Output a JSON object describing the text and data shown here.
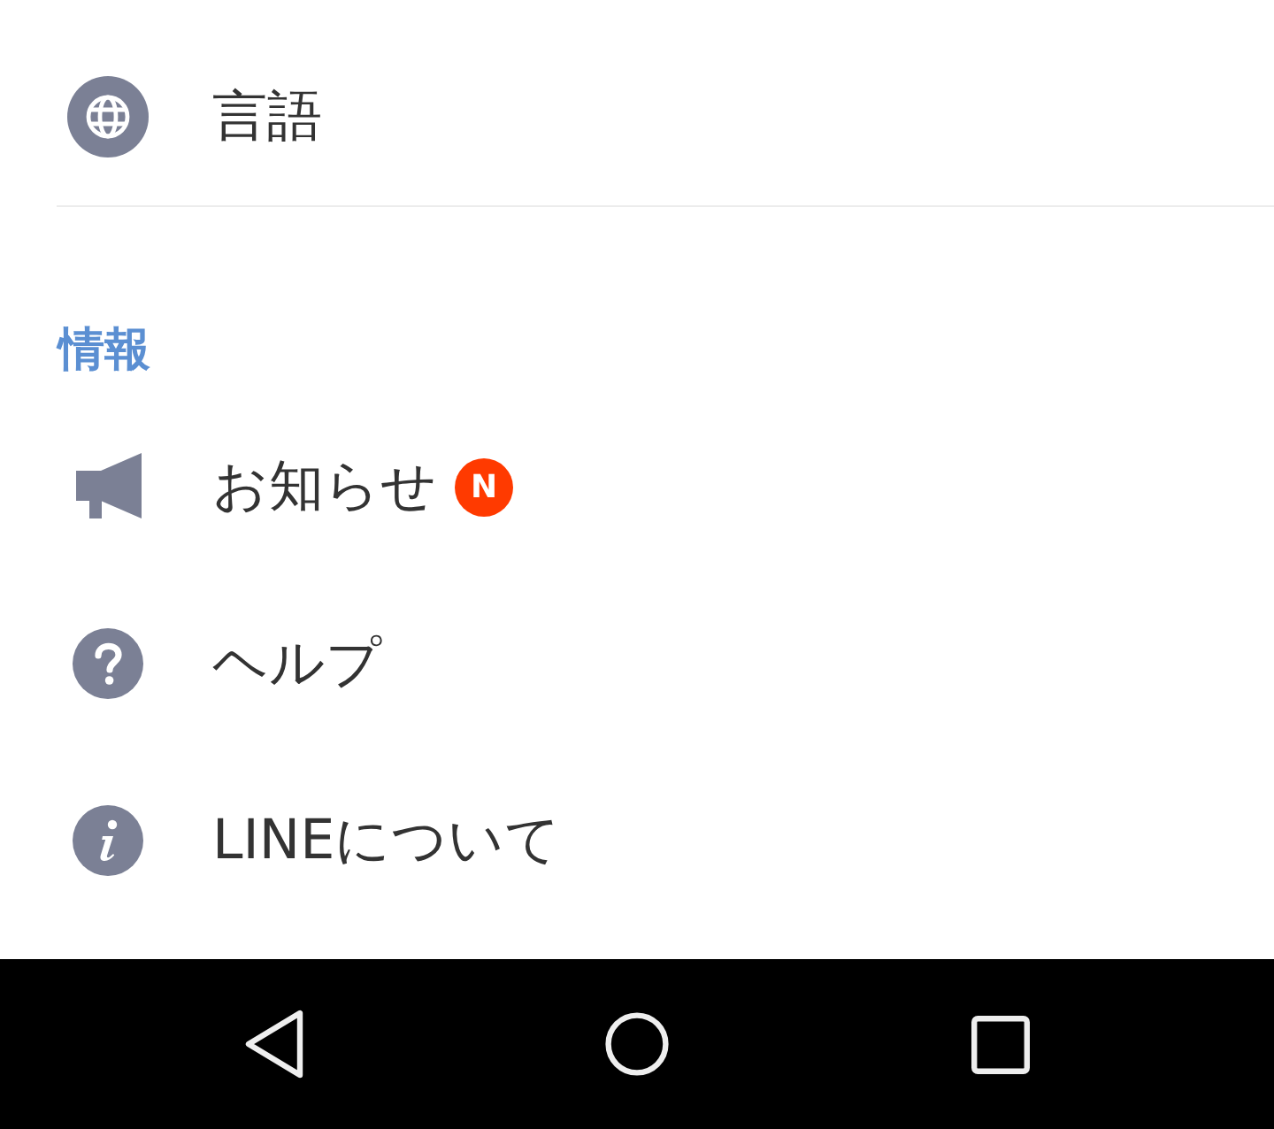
{
  "top_item": {
    "label": "言語"
  },
  "section": {
    "header": "情報",
    "items": [
      {
        "label": "お知らせ",
        "badge": "N"
      },
      {
        "label": "ヘルプ"
      },
      {
        "label": "LINEについて"
      }
    ]
  }
}
